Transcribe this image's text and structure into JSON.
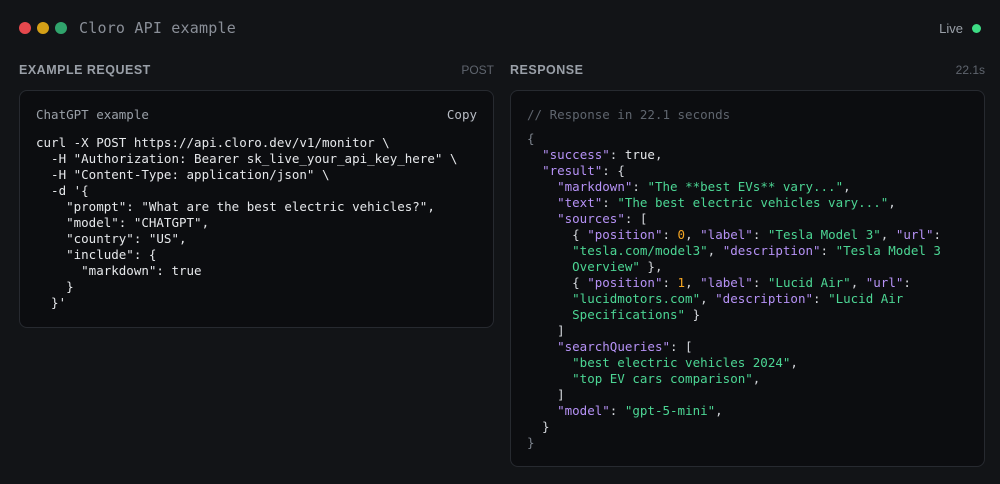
{
  "window": {
    "title": "Cloro API example",
    "status_label": "Live"
  },
  "request": {
    "section_title": "EXAMPLE REQUEST",
    "method": "POST",
    "panel_title": "ChatGPT example",
    "copy_label": "Copy",
    "lines": [
      "curl -X POST https://api.cloro.dev/v1/monitor \\",
      "  -H \"Authorization: Bearer sk_live_your_api_key_here\" \\",
      "  -H \"Content-Type: application/json\" \\",
      "  -d '{",
      "    \"prompt\": \"What are the best electric vehicles?\",",
      "    \"model\": \"CHATGPT\",",
      "    \"country\": \"US\",",
      "    \"include\": {",
      "      \"markdown\": true",
      "    }",
      "  }'"
    ]
  },
  "response": {
    "section_title": "RESPONSE",
    "duration": "22.1s",
    "comment": "// Response in 22.1 seconds",
    "lines": [
      [
        [
          "brace",
          "{"
        ]
      ],
      [
        [
          "p",
          "  "
        ],
        [
          "k",
          "\"success\""
        ],
        [
          "p",
          ": "
        ],
        [
          "b",
          "true"
        ],
        [
          "p",
          ","
        ]
      ],
      [
        [
          "p",
          "  "
        ],
        [
          "k",
          "\"result\""
        ],
        [
          "p",
          ": {"
        ]
      ],
      [
        [
          "p",
          "    "
        ],
        [
          "k",
          "\"markdown\""
        ],
        [
          "p",
          ": "
        ],
        [
          "s",
          "\"The **best EVs** vary...\""
        ],
        [
          "p",
          ","
        ]
      ],
      [
        [
          "p",
          "    "
        ],
        [
          "k",
          "\"text\""
        ],
        [
          "p",
          ": "
        ],
        [
          "s",
          "\"The best electric vehicles vary...\""
        ],
        [
          "p",
          ","
        ]
      ],
      [
        [
          "p",
          "    "
        ],
        [
          "k",
          "\"sources\""
        ],
        [
          "p",
          ": ["
        ]
      ],
      [
        [
          "p",
          "      { "
        ],
        [
          "k",
          "\"position\""
        ],
        [
          "p",
          ": "
        ],
        [
          "n",
          "0"
        ],
        [
          "p",
          ", "
        ],
        [
          "k",
          "\"label\""
        ],
        [
          "p",
          ": "
        ],
        [
          "s",
          "\"Tesla Model 3\""
        ],
        [
          "p",
          ", "
        ],
        [
          "k",
          "\"url\""
        ],
        [
          "p",
          ":"
        ]
      ],
      [
        [
          "p",
          "      "
        ],
        [
          "s",
          "\"tesla.com/model3\""
        ],
        [
          "p",
          ", "
        ],
        [
          "k",
          "\"description\""
        ],
        [
          "p",
          ": "
        ],
        [
          "s",
          "\"Tesla Model 3"
        ]
      ],
      [
        [
          "p",
          "      "
        ],
        [
          "s",
          "Overview\""
        ],
        [
          "p",
          " },"
        ]
      ],
      [
        [
          "p",
          "      { "
        ],
        [
          "k",
          "\"position\""
        ],
        [
          "p",
          ": "
        ],
        [
          "n",
          "1"
        ],
        [
          "p",
          ", "
        ],
        [
          "k",
          "\"label\""
        ],
        [
          "p",
          ": "
        ],
        [
          "s",
          "\"Lucid Air\""
        ],
        [
          "p",
          ", "
        ],
        [
          "k",
          "\"url\""
        ],
        [
          "p",
          ":"
        ]
      ],
      [
        [
          "p",
          "      "
        ],
        [
          "s",
          "\"lucidmotors.com\""
        ],
        [
          "p",
          ", "
        ],
        [
          "k",
          "\"description\""
        ],
        [
          "p",
          ": "
        ],
        [
          "s",
          "\"Lucid Air"
        ]
      ],
      [
        [
          "p",
          "      "
        ],
        [
          "s",
          "Specifications\""
        ],
        [
          "p",
          " }"
        ]
      ],
      [
        [
          "p",
          "    ]"
        ]
      ],
      [
        [
          "p",
          "    "
        ],
        [
          "k",
          "\"searchQueries\""
        ],
        [
          "p",
          ": ["
        ]
      ],
      [
        [
          "p",
          "      "
        ],
        [
          "s",
          "\"best electric vehicles 2024\""
        ],
        [
          "p",
          ","
        ]
      ],
      [
        [
          "p",
          "      "
        ],
        [
          "s",
          "\"top EV cars comparison\""
        ],
        [
          "p",
          ","
        ]
      ],
      [
        [
          "p",
          "    ]"
        ]
      ],
      [
        [
          "p",
          "    "
        ],
        [
          "k",
          "\"model\""
        ],
        [
          "p",
          ": "
        ],
        [
          "s",
          "\"gpt-5-mini\""
        ],
        [
          "p",
          ","
        ]
      ],
      [
        [
          "p",
          "  }"
        ]
      ],
      [
        [
          "brace",
          "}"
        ]
      ]
    ]
  },
  "colors": {
    "background": "#121417",
    "panel": "#0c0d10",
    "key": "#b692f6",
    "string": "#4cd694",
    "number": "#f5a623",
    "live": "#3ddc84"
  },
  "icons": [
    "close-dot",
    "minimize-dot",
    "maximize-dot",
    "live-status-dot"
  ]
}
